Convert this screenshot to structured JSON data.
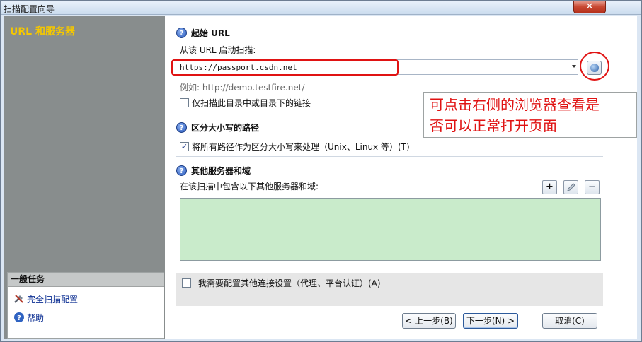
{
  "window": {
    "title": "扫描配置向导",
    "close_label": "✕"
  },
  "left_pane": {
    "header": "URL 和服务器",
    "tasks_header": "一般任务",
    "tasks": [
      {
        "label": "完全扫描配置",
        "icon": "tools-icon"
      },
      {
        "label": "帮助",
        "icon": "help-icon"
      }
    ]
  },
  "start_url": {
    "section_title": "起始 URL",
    "label": "从该 URL 启动扫描:",
    "value": "https://passport.csdn.net",
    "example": "例如: http://demo.testfire.net/",
    "only_dir_checkbox": {
      "label": "仅扫描此目录中或目录下的链接",
      "checked": false
    }
  },
  "annotation": {
    "text_line1": "可点击右侧的浏览器查看是",
    "text_line2": "否可以正常打开页面",
    "color": "#e01313"
  },
  "case_sensitive": {
    "section_title": "区分大小写的路径",
    "checkbox": {
      "label": "将所有路径作为区分大小写来处理（Unix、Linux 等）(T)",
      "checked": true
    }
  },
  "other_servers": {
    "section_title": "其他服务器和域",
    "label": "在该扫描中包含以下其他服务器和域:",
    "add_label": "+",
    "remove_label": "−",
    "list_color": "#c9ebcb"
  },
  "proxy": {
    "checkbox": {
      "label": "我需要配置其他连接设置（代理、平台认证）(A)",
      "checked": false
    }
  },
  "buttons": {
    "back": "< 上一步(B)",
    "next": "下一步(N) >",
    "cancel": "取消(C)"
  }
}
